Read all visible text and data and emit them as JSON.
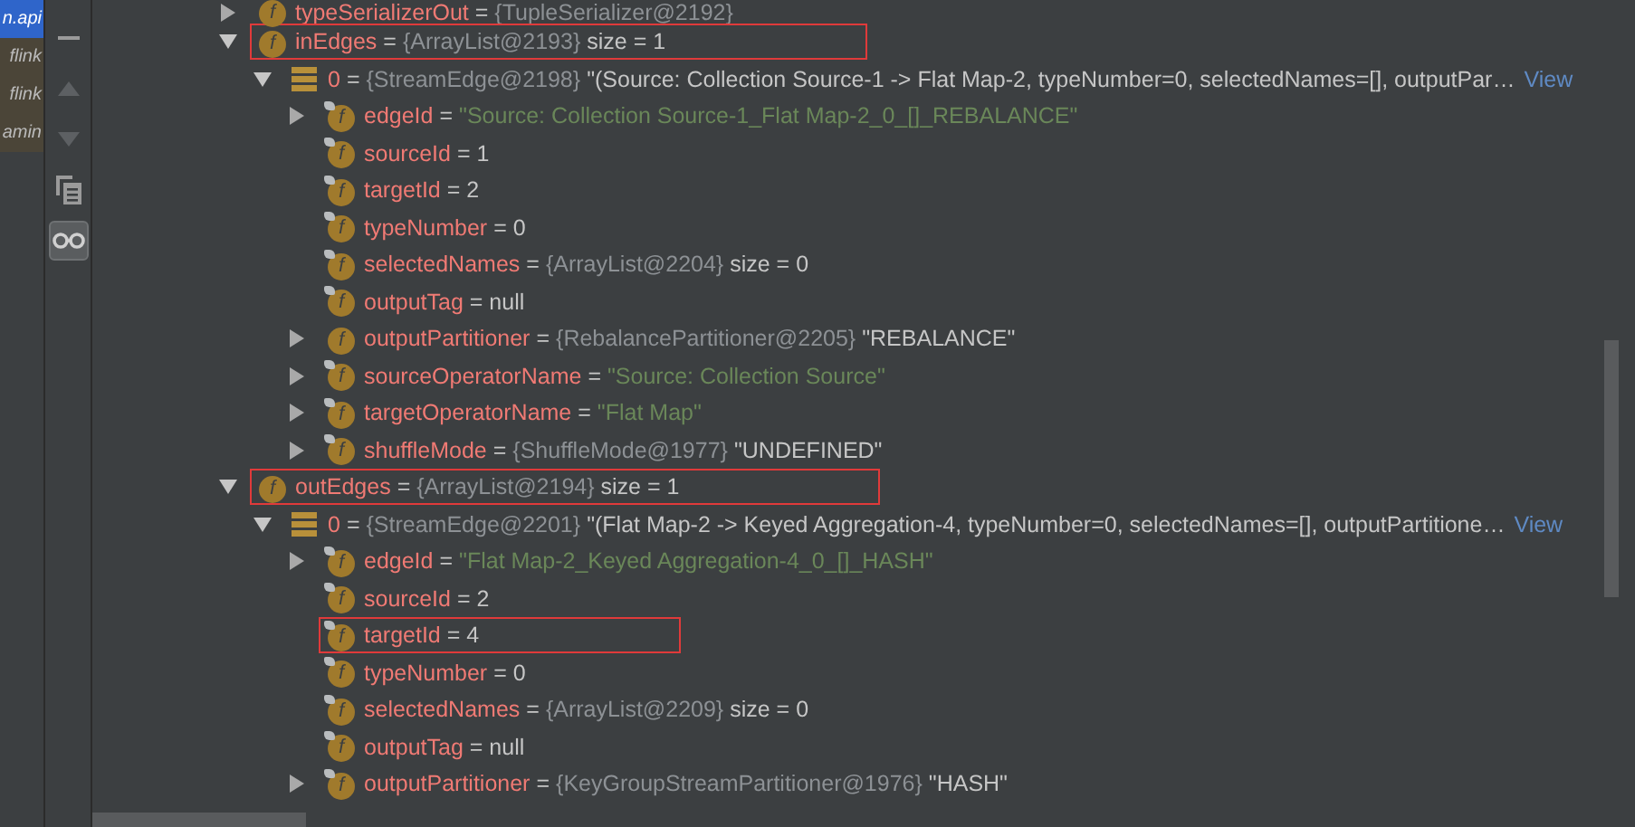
{
  "project_strip": [
    {
      "text": "n.api",
      "selected": true
    },
    {
      "text": "flink",
      "selected": false
    },
    {
      "text": "flink",
      "selected": false
    },
    {
      "text": "amin",
      "selected": false
    }
  ],
  "toolbar": [
    {
      "kind": "minus",
      "disabled": false,
      "selected": false
    },
    {
      "kind": "up",
      "disabled": true,
      "selected": false
    },
    {
      "kind": "down",
      "disabled": true,
      "selected": false
    },
    {
      "kind": "copy",
      "disabled": false,
      "selected": false
    },
    {
      "kind": "glasses",
      "disabled": false,
      "selected": true
    }
  ],
  "tree": {
    "nodes": [
      {
        "kind": "field",
        "icon": "f",
        "final": false,
        "expanded": false,
        "highlighted": false,
        "segments": [
          {
            "kind": "name",
            "text": "typeSerializerOut"
          },
          {
            "kind": "plain",
            "text": "="
          },
          {
            "kind": "type",
            "text": "{TupleSerializer@2192}"
          }
        ]
      },
      {
        "kind": "field",
        "icon": "f",
        "final": false,
        "expanded": true,
        "highlighted": true,
        "segments": [
          {
            "kind": "name",
            "text": "inEdges"
          },
          {
            "kind": "plain",
            "text": "="
          },
          {
            "kind": "type",
            "text": "{ArrayList@2193}"
          },
          {
            "kind": "plain",
            "text": " size = 1"
          }
        ],
        "children": [
          {
            "kind": "element",
            "expanded": true,
            "highlighted": false,
            "link": "View",
            "segments": [
              {
                "kind": "name",
                "text": "0"
              },
              {
                "kind": "plain",
                "text": "="
              },
              {
                "kind": "type",
                "text": "{StreamEdge@2198}"
              },
              {
                "kind": "plain",
                "text": "\"(Source: Collection Source-1 -> Flat Map-2, typeNumber=0, selectedNames=[], outputPar…"
              }
            ],
            "children": [
              {
                "kind": "field",
                "icon": "f",
                "final": true,
                "expanded": false,
                "highlighted": false,
                "segments": [
                  {
                    "kind": "name",
                    "text": "edgeId"
                  },
                  {
                    "kind": "plain",
                    "text": "="
                  },
                  {
                    "kind": "string",
                    "text": "\"Source: Collection Source-1_Flat Map-2_0_[]_REBALANCE\""
                  }
                ]
              },
              {
                "kind": "field",
                "icon": "f",
                "final": true,
                "highlighted": false,
                "segments": [
                  {
                    "kind": "name",
                    "text": "sourceId"
                  },
                  {
                    "kind": "plain",
                    "text": "= 1"
                  }
                ]
              },
              {
                "kind": "field",
                "icon": "f",
                "final": true,
                "highlighted": false,
                "segments": [
                  {
                    "kind": "name",
                    "text": "targetId"
                  },
                  {
                    "kind": "plain",
                    "text": "= 2"
                  }
                ]
              },
              {
                "kind": "field",
                "icon": "f",
                "final": true,
                "highlighted": false,
                "segments": [
                  {
                    "kind": "name",
                    "text": "typeNumber"
                  },
                  {
                    "kind": "plain",
                    "text": "= 0"
                  }
                ]
              },
              {
                "kind": "field",
                "icon": "f",
                "final": true,
                "highlighted": false,
                "segments": [
                  {
                    "kind": "name",
                    "text": "selectedNames"
                  },
                  {
                    "kind": "plain",
                    "text": "="
                  },
                  {
                    "kind": "type",
                    "text": "{ArrayList@2204}"
                  },
                  {
                    "kind": "plain",
                    "text": " size = 0"
                  }
                ]
              },
              {
                "kind": "field",
                "icon": "f",
                "final": true,
                "highlighted": false,
                "segments": [
                  {
                    "kind": "name",
                    "text": "outputTag"
                  },
                  {
                    "kind": "plain",
                    "text": "= null"
                  }
                ]
              },
              {
                "kind": "field",
                "icon": "f",
                "final": false,
                "expanded": false,
                "highlighted": false,
                "segments": [
                  {
                    "kind": "name",
                    "text": "outputPartitioner"
                  },
                  {
                    "kind": "plain",
                    "text": "="
                  },
                  {
                    "kind": "type",
                    "text": "{RebalancePartitioner@2205}"
                  },
                  {
                    "kind": "plain",
                    "text": "\"REBALANCE\""
                  }
                ]
              },
              {
                "kind": "field",
                "icon": "f",
                "final": true,
                "expanded": false,
                "highlighted": false,
                "segments": [
                  {
                    "kind": "name",
                    "text": "sourceOperatorName"
                  },
                  {
                    "kind": "plain",
                    "text": "="
                  },
                  {
                    "kind": "string",
                    "text": "\"Source: Collection Source\""
                  }
                ]
              },
              {
                "kind": "field",
                "icon": "f",
                "final": true,
                "expanded": false,
                "highlighted": false,
                "segments": [
                  {
                    "kind": "name",
                    "text": "targetOperatorName"
                  },
                  {
                    "kind": "plain",
                    "text": "="
                  },
                  {
                    "kind": "string",
                    "text": "\"Flat Map\""
                  }
                ]
              },
              {
                "kind": "field",
                "icon": "f",
                "final": true,
                "expanded": false,
                "highlighted": false,
                "segments": [
                  {
                    "kind": "name",
                    "text": "shuffleMode"
                  },
                  {
                    "kind": "plain",
                    "text": "="
                  },
                  {
                    "kind": "type",
                    "text": "{ShuffleMode@1977}"
                  },
                  {
                    "kind": "plain",
                    "text": "\"UNDEFINED\""
                  }
                ]
              }
            ]
          }
        ]
      },
      {
        "kind": "field",
        "icon": "f",
        "final": false,
        "expanded": true,
        "highlighted": true,
        "segments": [
          {
            "kind": "name",
            "text": "outEdges"
          },
          {
            "kind": "plain",
            "text": "="
          },
          {
            "kind": "type",
            "text": "{ArrayList@2194}"
          },
          {
            "kind": "plain",
            "text": " size = 1"
          }
        ],
        "children": [
          {
            "kind": "element",
            "expanded": true,
            "highlighted": false,
            "link": "View",
            "segments": [
              {
                "kind": "name",
                "text": "0"
              },
              {
                "kind": "plain",
                "text": "="
              },
              {
                "kind": "type",
                "text": "{StreamEdge@2201}"
              },
              {
                "kind": "plain",
                "text": "\"(Flat Map-2 -> Keyed Aggregation-4, typeNumber=0, selectedNames=[], outputPartitione…"
              }
            ],
            "children": [
              {
                "kind": "field",
                "icon": "f",
                "final": true,
                "expanded": false,
                "highlighted": false,
                "segments": [
                  {
                    "kind": "name",
                    "text": "edgeId"
                  },
                  {
                    "kind": "plain",
                    "text": "="
                  },
                  {
                    "kind": "string",
                    "text": "\"Flat Map-2_Keyed Aggregation-4_0_[]_HASH\""
                  }
                ]
              },
              {
                "kind": "field",
                "icon": "f",
                "final": true,
                "highlighted": false,
                "segments": [
                  {
                    "kind": "name",
                    "text": "sourceId"
                  },
                  {
                    "kind": "plain",
                    "text": "= 2"
                  }
                ]
              },
              {
                "kind": "field",
                "icon": "f",
                "final": true,
                "highlighted": true,
                "segments": [
                  {
                    "kind": "name",
                    "text": "targetId"
                  },
                  {
                    "kind": "plain",
                    "text": "= 4"
                  }
                ]
              },
              {
                "kind": "field",
                "icon": "f",
                "final": true,
                "highlighted": false,
                "segments": [
                  {
                    "kind": "name",
                    "text": "typeNumber"
                  },
                  {
                    "kind": "plain",
                    "text": "= 0"
                  }
                ]
              },
              {
                "kind": "field",
                "icon": "f",
                "final": true,
                "highlighted": false,
                "segments": [
                  {
                    "kind": "name",
                    "text": "selectedNames"
                  },
                  {
                    "kind": "plain",
                    "text": "="
                  },
                  {
                    "kind": "type",
                    "text": "{ArrayList@2209}"
                  },
                  {
                    "kind": "plain",
                    "text": " size = 0"
                  }
                ]
              },
              {
                "kind": "field",
                "icon": "f",
                "final": true,
                "highlighted": false,
                "segments": [
                  {
                    "kind": "name",
                    "text": "outputTag"
                  },
                  {
                    "kind": "plain",
                    "text": "= null"
                  }
                ]
              },
              {
                "kind": "field",
                "icon": "f",
                "final": true,
                "expanded": false,
                "highlighted": false,
                "segments": [
                  {
                    "kind": "name",
                    "text": "outputPartitioner"
                  },
                  {
                    "kind": "plain",
                    "text": "="
                  },
                  {
                    "kind": "type",
                    "text": "{KeyGroupStreamPartitioner@1976}"
                  },
                  {
                    "kind": "plain",
                    "text": "\"HASH\""
                  }
                ]
              }
            ]
          }
        ]
      }
    ]
  }
}
